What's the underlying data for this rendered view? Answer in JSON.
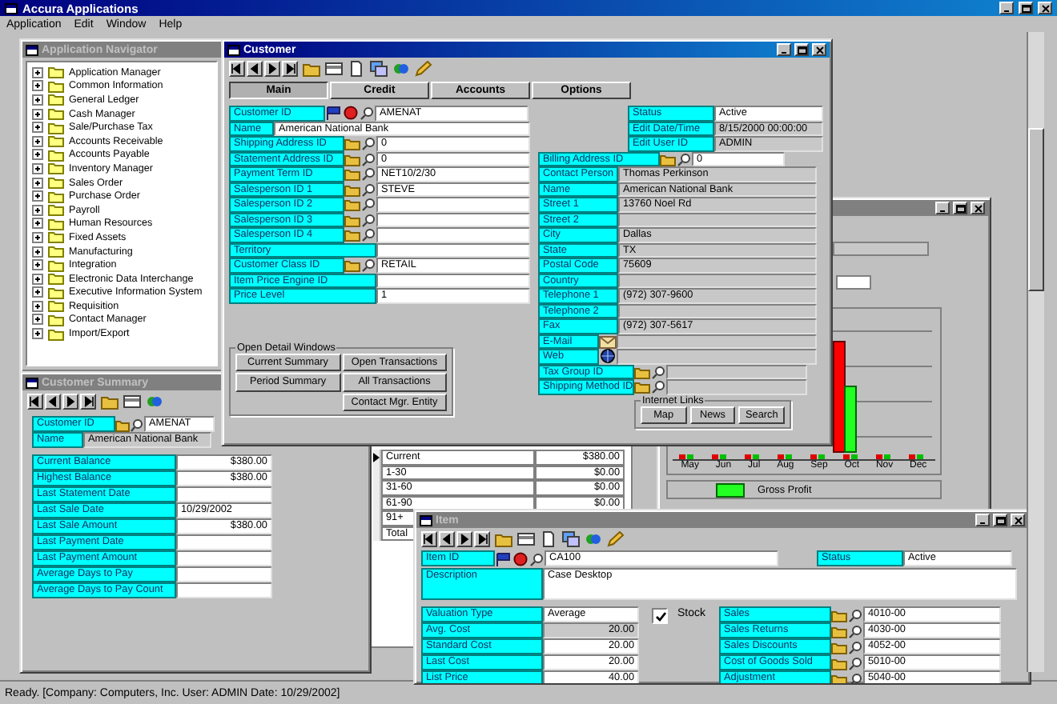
{
  "app": {
    "title": "Accura Applications",
    "menu": [
      "Application",
      "Edit",
      "Window",
      "Help"
    ],
    "status": "Ready. [Company: Computers, Inc. User: ADMIN Date: 10/29/2002]"
  },
  "navigator": {
    "title": "Application Navigator",
    "active": false,
    "items": [
      {
        "label": "Application Manager",
        "expanded": false
      },
      {
        "label": "Common Information",
        "expanded": false
      },
      {
        "label": "General Ledger",
        "expanded": false
      },
      {
        "label": "Cash Manager",
        "expanded": false
      },
      {
        "label": "Sale/Purchase Tax",
        "expanded": false
      },
      {
        "label": "Accounts Receivable",
        "expanded": false
      },
      {
        "label": "Accounts Payable",
        "expanded": false
      },
      {
        "label": "Inventory Manager",
        "expanded": false
      },
      {
        "label": "Sales Order",
        "expanded": false
      },
      {
        "label": "Purchase Order",
        "expanded": false
      },
      {
        "label": "Payroll",
        "expanded": false
      },
      {
        "label": "Human Resources",
        "expanded": false
      },
      {
        "label": "Fixed Assets",
        "expanded": false
      },
      {
        "label": "Manufacturing",
        "expanded": false
      },
      {
        "label": "Integration",
        "expanded": false
      },
      {
        "label": "Electronic Data Interchange",
        "expanded": false
      },
      {
        "label": "Executive Information System",
        "expanded": false
      },
      {
        "label": "Requisition",
        "expanded": false
      },
      {
        "label": "Contact Manager",
        "expanded": false
      },
      {
        "label": "Import/Export",
        "expanded": false
      }
    ]
  },
  "customer": {
    "title": "Customer",
    "active": true,
    "tabs": [
      {
        "label": "Main",
        "selected": true
      },
      {
        "label": "Credit",
        "selected": false
      },
      {
        "label": "Accounts",
        "selected": false
      },
      {
        "label": "Options",
        "selected": false
      }
    ],
    "fields": [
      {
        "label": "Customer ID",
        "value": "AMENAT",
        "kind": "key"
      },
      {
        "label": "Name",
        "value": "American National Bank",
        "kind": "wide"
      },
      {
        "label": "Shipping Address ID",
        "value": "0",
        "kind": "lookup"
      },
      {
        "label": "Statement Address ID",
        "value": "0",
        "kind": "lookup"
      },
      {
        "label": "Payment Term ID",
        "value": "NET10/2/30",
        "kind": "lookup"
      },
      {
        "label": "Salesperson ID 1",
        "value": "STEVE",
        "kind": "lookup"
      },
      {
        "label": "Salesperson ID 2",
        "kind": "lookup"
      },
      {
        "label": "Salesperson ID 3",
        "kind": "lookup"
      },
      {
        "label": "Salesperson ID 4",
        "kind": "lookup"
      },
      {
        "label": "Territory",
        "kind": "plain"
      },
      {
        "label": "Customer Class ID",
        "value": "RETAIL",
        "kind": "lookup"
      },
      {
        "label": "Item Price Engine ID",
        "kind": "plain"
      },
      {
        "label": "Price Level",
        "value": "1",
        "kind": "plain"
      }
    ],
    "status_fields": [
      {
        "label": "Status",
        "value": "Active"
      },
      {
        "label": "Edit Date/Time",
        "value": "8/15/2000 00:00:00"
      },
      {
        "label": "Edit User ID",
        "value": "ADMIN"
      }
    ],
    "billing_fields": [
      {
        "label": "Billing Address ID",
        "value": "0",
        "kind": "lookup"
      },
      {
        "label": "Contact Person",
        "value": "Thomas Perkinson",
        "kind": "text"
      },
      {
        "label": "Name",
        "value": "American National Bank",
        "kind": "text"
      },
      {
        "label": "Street 1",
        "value": "13760 Noel Rd",
        "kind": "text"
      },
      {
        "label": "Street 2",
        "kind": "text"
      },
      {
        "label": "City",
        "value": "Dallas",
        "kind": "text"
      },
      {
        "label": "State",
        "value": "TX",
        "kind": "text"
      },
      {
        "label": "Postal Code",
        "value": "75609",
        "kind": "text"
      },
      {
        "label": "Country",
        "kind": "text"
      },
      {
        "label": "Telephone 1",
        "value": "(972) 307-9600",
        "kind": "text"
      },
      {
        "label": "Telephone 2",
        "kind": "text"
      },
      {
        "label": "Fax",
        "value": "(972) 307-5617",
        "kind": "text"
      },
      {
        "label": "E-Mail",
        "kind": "email"
      },
      {
        "label": "Web",
        "kind": "web"
      },
      {
        "label": "Tax Group ID",
        "kind": "lookup"
      },
      {
        "label": "Shipping Method ID",
        "kind": "lookup"
      }
    ],
    "detail_windows": {
      "title": "Open Detail Windows",
      "buttons": [
        "Current Summary",
        "Open Transactions",
        "Period Summary",
        "All Transactions",
        "Contact Mgr. Entity"
      ]
    },
    "internet_links": {
      "title": "Internet Links",
      "buttons": [
        "Map",
        "News",
        "Search"
      ]
    }
  },
  "customer_summary": {
    "title": "Customer Summary",
    "active": false,
    "fields": [
      {
        "label": "Customer ID",
        "value": "AMENAT",
        "kind": "key"
      },
      {
        "label": "Name",
        "value": "American National Bank",
        "kind": "wide"
      },
      {
        "label": "Current Balance",
        "value": "$380.00",
        "kind": "amount"
      },
      {
        "label": "Highest Balance",
        "value": "$380.00",
        "kind": "amount"
      },
      {
        "label": "Last Statement Date",
        "kind": "text"
      },
      {
        "label": "Last Sale Date",
        "value": "10/29/2002",
        "kind": "text"
      },
      {
        "label": "Last Sale Amount",
        "value": "$380.00",
        "kind": "amount"
      },
      {
        "label": "Last Payment Date",
        "kind": "text"
      },
      {
        "label": "Last Payment Amount",
        "kind": "text"
      },
      {
        "label": "Average Days to Pay",
        "kind": "text"
      },
      {
        "label": "Average Days to Pay Count",
        "kind": "text"
      }
    ]
  },
  "aging": {
    "rows": [
      {
        "bucket": "Current",
        "amount": "$380.00",
        "selected": true
      },
      {
        "bucket": "1-30",
        "amount": "$0.00",
        "selected": false
      },
      {
        "bucket": "31-60",
        "amount": "$0.00",
        "selected": false
      },
      {
        "bucket": "61-90",
        "amount": "$0.00",
        "selected": false
      },
      {
        "bucket": "91+",
        "selected": false
      },
      {
        "bucket": "Total",
        "selected": false
      }
    ]
  },
  "profit_chart": {
    "active": false,
    "months": [
      "May",
      "Jun",
      "Jul",
      "Aug",
      "Sep",
      "Oct",
      "Nov",
      "Dec"
    ],
    "legend": "Gross Profit"
  },
  "item": {
    "title": "Item",
    "active": false,
    "item_id": {
      "label": "Item ID",
      "value": "CA100"
    },
    "status": {
      "label": "Status",
      "value": "Active"
    },
    "description": {
      "label": "Description",
      "value": "Case Desktop"
    },
    "valuation": {
      "label": "Valuation Type",
      "value": "Average"
    },
    "stock": {
      "label": "Stock",
      "checked": true
    },
    "costs": [
      {
        "label": "Avg. Cost",
        "value": "20.00",
        "disabled": true
      },
      {
        "label": "Standard Cost",
        "value": "20.00",
        "disabled": false
      },
      {
        "label": "Last Cost",
        "value": "20.00",
        "disabled": false
      },
      {
        "label": "List Price",
        "value": "40.00",
        "disabled": false
      }
    ],
    "accounts": [
      {
        "label": "Sales",
        "value": "4010-00"
      },
      {
        "label": "Sales Returns",
        "value": "4030-00"
      },
      {
        "label": "Sales Discounts",
        "value": "4052-00"
      },
      {
        "label": "Cost of Goods Sold",
        "value": "5010-00"
      },
      {
        "label": "Adjustment",
        "value": "5040-00"
      }
    ]
  }
}
